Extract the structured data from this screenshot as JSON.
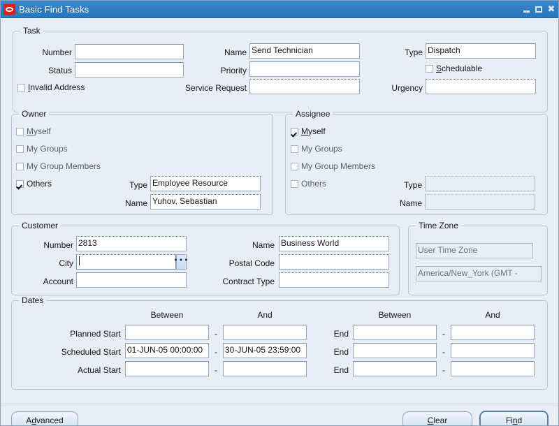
{
  "window": {
    "title": "Basic Find Tasks",
    "logo_icon": "oracle-logo-icon",
    "minimize_icon": "minimize-icon",
    "maximize_icon": "maximize-icon",
    "close_icon": "close-icon"
  },
  "task": {
    "legend": "Task",
    "number_label": "Number",
    "number_value": "",
    "status_label": "Status",
    "status_value": "",
    "invalid_address_label": "Invalid Address",
    "invalid_address_checked": false,
    "name_label": "Name",
    "name_value": "Send  Technician",
    "priority_label": "Priority",
    "priority_value": "",
    "service_request_label": "Service Request",
    "service_request_value": "",
    "type_label": "Type",
    "type_value": "Dispatch",
    "schedulable_label": "Schedulable",
    "schedulable_checked": false,
    "urgency_label": "Urgency",
    "urgency_value": ""
  },
  "owner": {
    "legend": "Owner",
    "myself_label": "Myself",
    "myself_checked": false,
    "my_groups_label": "My Groups",
    "my_groups_checked": false,
    "my_group_members_label": "My Group Members",
    "my_group_members_checked": false,
    "others_label": "Others",
    "others_checked": true,
    "type_label": "Type",
    "type_value": "Employee Resource",
    "name_label": "Name",
    "name_value": "Yuhov, Sebastian"
  },
  "assignee": {
    "legend": "Assignee",
    "myself_label": "Myself",
    "myself_checked": true,
    "my_groups_label": "My Groups",
    "my_groups_checked": false,
    "my_group_members_label": "My Group Members",
    "my_group_members_checked": false,
    "others_label": "Others",
    "others_checked": false,
    "type_label": "Type",
    "type_value": "",
    "name_label": "Name",
    "name_value": ""
  },
  "customer": {
    "legend": "Customer",
    "number_label": "Number",
    "number_value": "2813",
    "city_label": "City",
    "city_value": "",
    "account_label": "Account",
    "account_value": "",
    "name_label": "Name",
    "name_value": "Business World",
    "postal_code_label": "Postal Code",
    "postal_code_value": "",
    "contract_type_label": "Contract Type",
    "contract_type_value": "",
    "lov_icon": "list-of-values-icon"
  },
  "time_zone": {
    "legend": "Time Zone",
    "user_time_zone_value": "User Time Zone",
    "time_zone_value": "America/New_York (GMT -"
  },
  "dates": {
    "legend": "Dates",
    "between_label_left": "Between",
    "and_label_left": "And",
    "between_label_right": "Between",
    "and_label_right": "And",
    "dash": "-",
    "rows": [
      {
        "start_label": "Planned Start",
        "start_between": "",
        "start_and": "",
        "end_label": "End",
        "end_between": "",
        "end_and": ""
      },
      {
        "start_label": "Scheduled Start",
        "start_between": "01-JUN-05 00:00:00",
        "start_and": "30-JUN-05 23:59:00",
        "end_label": "End",
        "end_between": "",
        "end_and": ""
      },
      {
        "start_label": "Actual Start",
        "start_between": "",
        "start_and": "",
        "end_label": "End",
        "end_between": "",
        "end_and": ""
      }
    ]
  },
  "buttons": {
    "advanced": "Advanced",
    "advanced_mnemonic": "d",
    "clear": "Clear",
    "clear_mnemonic": "C",
    "find": "Find",
    "find_mnemonic": "n"
  },
  "colors": {
    "titlebar": "#2f7cc2",
    "canvas": "#e9eef6",
    "field_border": "#93a7c0",
    "group_border": "#b7c4d8",
    "oracle_red": "#e21b1b",
    "text": "#13171c"
  }
}
